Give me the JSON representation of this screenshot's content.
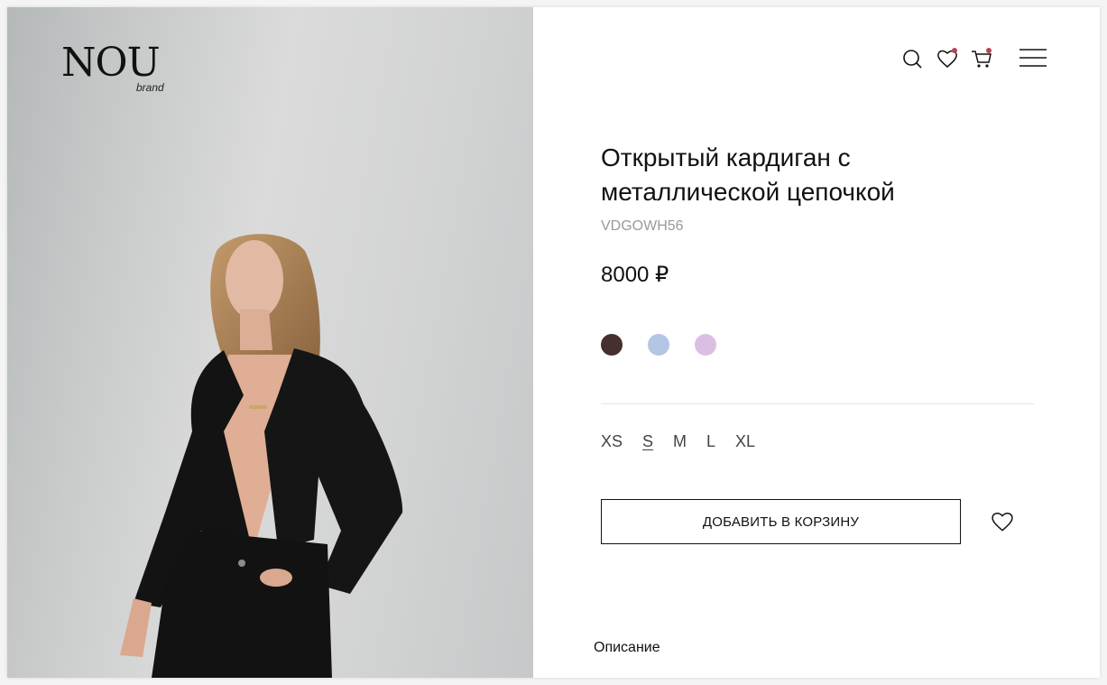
{
  "brand": {
    "logo_main": "NOU",
    "logo_sub": "brand"
  },
  "header": {
    "icons": [
      "search-icon",
      "heart-icon",
      "cart-icon",
      "menu-icon"
    ],
    "badge_color": "#b5435a"
  },
  "product": {
    "title": "Открытый кардиган с металлической цепочкой",
    "sku": "VDGOWH56",
    "price": "8000 ₽",
    "colors": [
      {
        "name": "dark-brown",
        "hex": "#452f2f"
      },
      {
        "name": "light-blue",
        "hex": "#b3c6e4"
      },
      {
        "name": "lilac",
        "hex": "#dbbfe3"
      }
    ],
    "sizes": [
      "XS",
      "S",
      "M",
      "L",
      "XL"
    ],
    "selected_size": "S",
    "add_to_cart_label": "ДОБАВИТЬ В КОРЗИНУ",
    "description_label": "Описание"
  }
}
